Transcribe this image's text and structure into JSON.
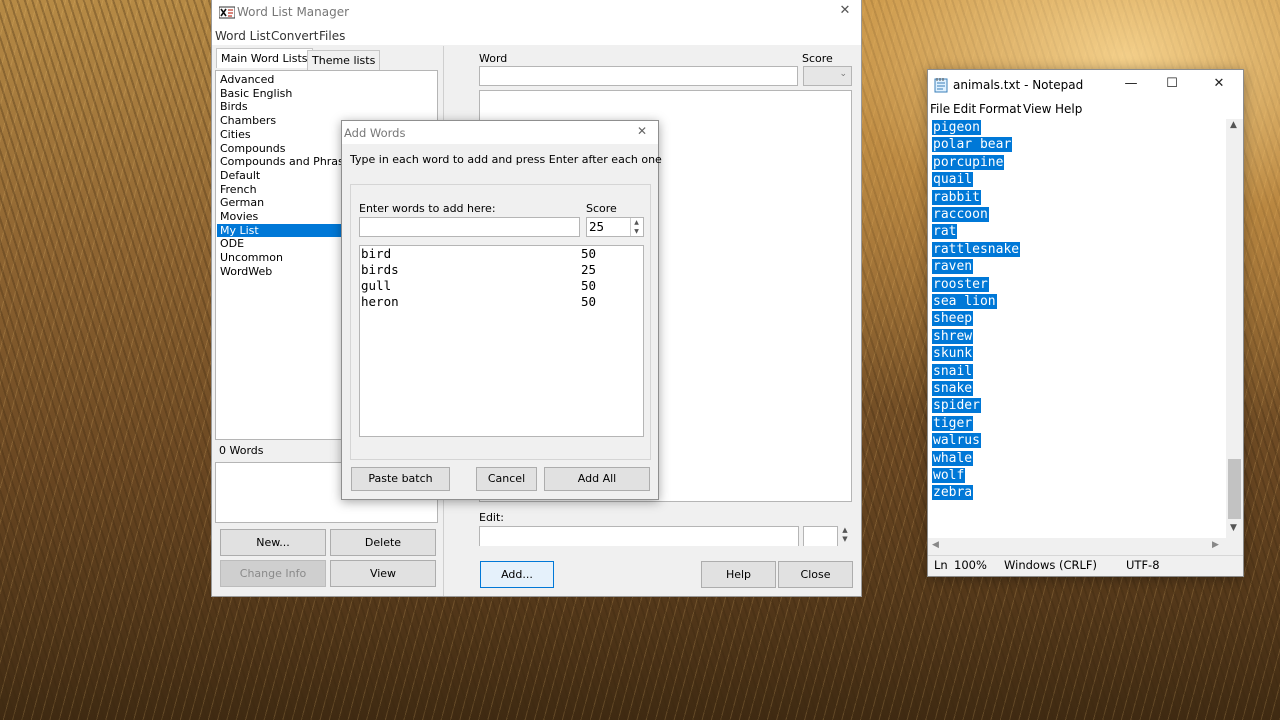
{
  "wlm": {
    "title": "Word List Manager",
    "menu": [
      "Word List",
      "Convert",
      "Files"
    ],
    "tabs": [
      "Main Word Lists",
      "Theme lists"
    ],
    "lists": [
      "Advanced",
      "Basic English",
      "Birds",
      "Chambers",
      "Cities",
      "Compounds",
      "Compounds and Phrases",
      "Default",
      "French",
      "German",
      "Movies",
      "My List",
      "ODE",
      "Uncommon",
      "WordWeb"
    ],
    "selected_list": "My List",
    "word_count": "0 Words",
    "buttons": {
      "new": "New...",
      "delete": "Delete",
      "change_info": "Change Info",
      "view": "View",
      "add": "Add...",
      "help": "Help",
      "close": "Close"
    },
    "word_label": "Word",
    "score_label": "Score",
    "edit_label": "Edit:",
    "close_glyph": "✕"
  },
  "dialog": {
    "title": "Add Words",
    "close_glyph": "✕",
    "instruction": "Type in each word to add and press Enter after each one",
    "enter_label": "Enter words to add here:",
    "score_label": "Score",
    "score_value": "25",
    "rows": [
      {
        "word": "bird",
        "score": "50"
      },
      {
        "word": "birds",
        "score": "25"
      },
      {
        "word": "gull",
        "score": "50"
      },
      {
        "word": "heron",
        "score": "50"
      }
    ],
    "buttons": {
      "paste": "Paste batch",
      "cancel": "Cancel",
      "add_all": "Add All"
    }
  },
  "notepad": {
    "title": "animals.txt - Notepad",
    "menu": [
      "File",
      "Edit",
      "Format",
      "View",
      "Help"
    ],
    "controls": {
      "min": "—",
      "max": "☐",
      "close": "✕"
    },
    "lines": [
      "pigeon",
      "polar bear",
      "porcupine",
      "quail",
      "rabbit",
      "raccoon",
      "rat",
      "rattlesnake",
      "raven",
      "rooster",
      "sea lion",
      "sheep",
      "shrew",
      "skunk",
      "snail",
      "snake",
      "spider",
      "tiger",
      "walrus",
      "whale",
      "wolf",
      "zebra"
    ],
    "status": {
      "ln": "Ln",
      "zoom": "100%",
      "eol": "Windows (CRLF)",
      "encoding": "UTF-8"
    }
  }
}
